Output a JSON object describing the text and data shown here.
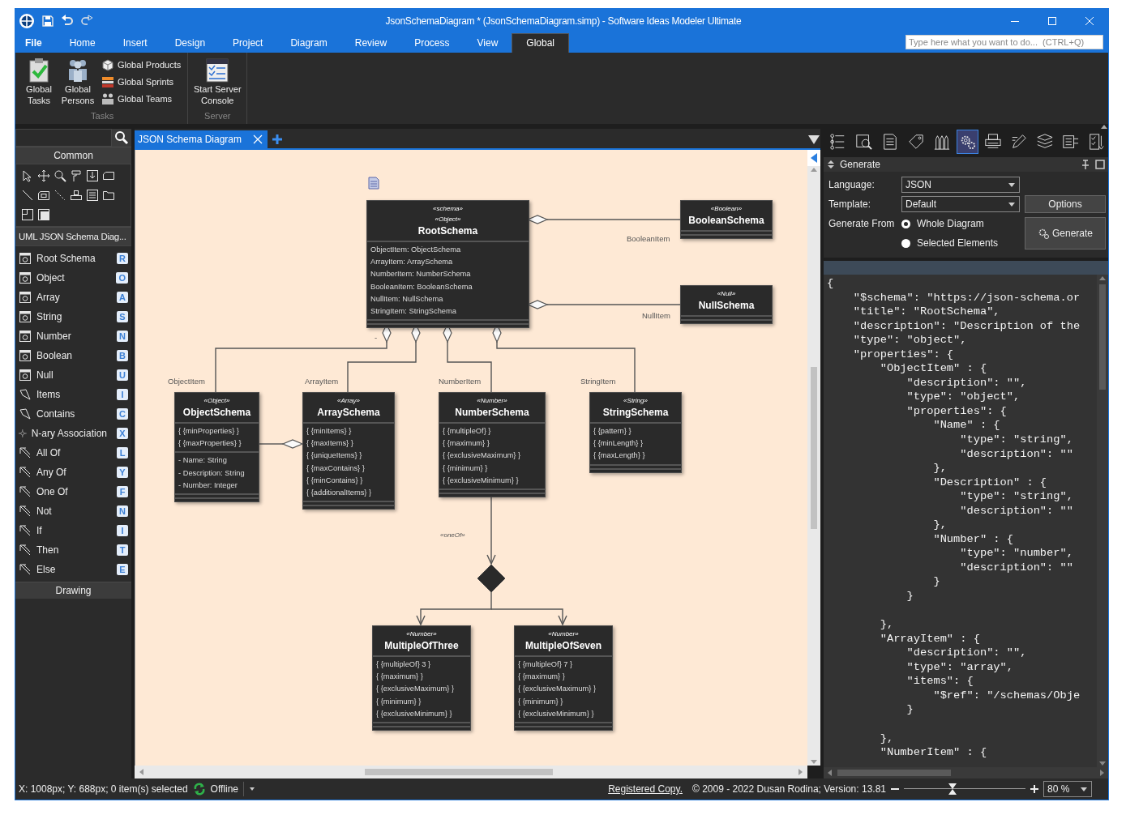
{
  "window": {
    "title": "JsonSchemaDiagram * (JsonSchemaDiagram.simp) - Software Ideas Modeler Ultimate"
  },
  "menu_tabs": [
    {
      "label": "File",
      "selected": false
    },
    {
      "label": "Home",
      "selected": false
    },
    {
      "label": "Insert",
      "selected": false
    },
    {
      "label": "Design",
      "selected": false
    },
    {
      "label": "Project",
      "selected": false
    },
    {
      "label": "Diagram",
      "selected": false
    },
    {
      "label": "Review",
      "selected": false
    },
    {
      "label": "Process",
      "selected": false
    },
    {
      "label": "View",
      "selected": false
    },
    {
      "label": "Global",
      "selected": true
    }
  ],
  "command_search": {
    "placeholder": "Type here what you want to do...  (CTRL+Q)"
  },
  "ribbon": {
    "groups": [
      {
        "label": "Tasks",
        "large_buttons": [
          {
            "label": "Global Tasks",
            "kind": "tasks"
          },
          {
            "label": "Global Persons",
            "kind": "persons"
          }
        ],
        "small_buttons": [
          {
            "label": "Global Products",
            "kind": "products"
          },
          {
            "label": "Global Sprints",
            "kind": "sprints"
          },
          {
            "label": "Global Teams",
            "kind": "teams"
          }
        ]
      },
      {
        "label": "Server",
        "large_buttons": [
          {
            "label": "Start Server Console",
            "kind": "console"
          }
        ]
      }
    ]
  },
  "toolbox": {
    "common_header": "Common",
    "diagram_header": "UML JSON Schema Diag...",
    "items": [
      {
        "label": "Root Schema",
        "shortcut": "R",
        "kind": "element"
      },
      {
        "label": "Object",
        "shortcut": "O",
        "kind": "element"
      },
      {
        "label": "Array",
        "shortcut": "A",
        "kind": "element"
      },
      {
        "label": "String",
        "shortcut": "S",
        "kind": "element"
      },
      {
        "label": "Number",
        "shortcut": "N",
        "kind": "element"
      },
      {
        "label": "Boolean",
        "shortcut": "B",
        "kind": "element"
      },
      {
        "label": "Null",
        "shortcut": "U",
        "kind": "element"
      },
      {
        "label": "Items",
        "shortcut": "I",
        "kind": "link"
      },
      {
        "label": "Contains",
        "shortcut": "C",
        "kind": "link"
      },
      {
        "label": "N-ary Association",
        "shortcut": "X",
        "kind": "nary"
      },
      {
        "label": "All Of",
        "shortcut": "L",
        "kind": "arrow"
      },
      {
        "label": "Any Of",
        "shortcut": "Y",
        "kind": "arrow"
      },
      {
        "label": "One Of",
        "shortcut": "F",
        "kind": "arrow"
      },
      {
        "label": "Not",
        "shortcut": "N",
        "kind": "arrow"
      },
      {
        "label": "If",
        "shortcut": "I",
        "kind": "arrow"
      },
      {
        "label": "Then",
        "shortcut": "T",
        "kind": "arrow"
      },
      {
        "label": "Else",
        "shortcut": "E",
        "kind": "arrow"
      }
    ],
    "drawing_header": "Drawing"
  },
  "document_tabs": [
    {
      "label": "JSON Schema Diagram",
      "selected": true
    }
  ],
  "diagram": {
    "nodes": [
      {
        "stereotypes": [
          "«schema»",
          "«Object»"
        ],
        "name": "RootSchema",
        "sections": [
          [
            "ObjectItem: ObjectSchema",
            "ArrayItem: ArraySchema",
            "NumberItem: NumberSchema",
            "BooleanItem: BooleanSchema",
            "NullItem: NullSchema",
            "StringItem: StringSchema"
          ]
        ]
      },
      {
        "stereotypes": [
          "«Boolean»"
        ],
        "name": "BooleanSchema"
      },
      {
        "stereotypes": [
          "«Null»"
        ],
        "name": "NullSchema"
      },
      {
        "stereotypes": [
          "«Object»"
        ],
        "name": "ObjectSchema",
        "sections": [
          [
            "{ {minProperties} }",
            "{ {maxProperties} }"
          ],
          [
            "- Name: String",
            "- Description: String",
            "- Number: Integer"
          ]
        ]
      },
      {
        "stereotypes": [
          "«Array»"
        ],
        "name": "ArraySchema",
        "sections": [
          [
            "{ {minItems} }",
            "{ {maxItems} }",
            "{ {uniqueItems} }",
            "{ {maxContains} }",
            "{ {minContains} }",
            "{ {additionalItems} }"
          ]
        ]
      },
      {
        "stereotypes": [
          "«Number»"
        ],
        "name": "NumberSchema",
        "sections": [
          [
            "{ {multipleOf} }",
            "{ {maximum} }",
            "{ {exclusiveMaximum} }",
            "{ {minimum} }",
            "{ {exclusiveMinimum} }"
          ]
        ]
      },
      {
        "stereotypes": [
          "«String»"
        ],
        "name": "StringSchema",
        "sections": [
          [
            "{ {pattern} }",
            "{ {minLength} }",
            "{ {maxLength} }"
          ]
        ]
      },
      {
        "stereotypes": [
          "«Number»"
        ],
        "name": "MultipleOfThree",
        "sections": [
          [
            "{ {multipleOf} 3 }",
            "{ {maximum} }",
            "{ {exclusiveMaximum} }",
            "{ {minimum} }",
            "{ {exclusiveMinimum} }"
          ]
        ]
      },
      {
        "stereotypes": [
          "«Number»"
        ],
        "name": "MultipleOfSeven",
        "sections": [
          [
            "{ {multipleOf} 7 }",
            "{ {maximum} }",
            "{ {exclusiveMaximum} }",
            "{ {minimum} }",
            "{ {exclusiveMinimum} }"
          ]
        ]
      }
    ],
    "connector_labels": [
      "BooleanItem",
      "NullItem",
      "ObjectItem",
      "ArrayItem",
      "NumberItem",
      "StringItem",
      "«oneOf»",
      "-"
    ]
  },
  "panel_tools": [
    {
      "kind": "tree",
      "selected": false
    },
    {
      "kind": "magnifier",
      "selected": false
    },
    {
      "kind": "document",
      "selected": false
    },
    {
      "kind": "tag",
      "selected": false
    },
    {
      "kind": "pencils",
      "selected": false
    },
    {
      "kind": "gear",
      "selected": true
    },
    {
      "kind": "printer",
      "selected": false
    },
    {
      "kind": "pen",
      "selected": false
    },
    {
      "kind": "layers",
      "selected": false
    },
    {
      "kind": "list",
      "selected": false
    },
    {
      "kind": "checklist",
      "selected": false
    }
  ],
  "generate_panel": {
    "title": "Generate",
    "language_label": "Language:",
    "language": "JSON",
    "template_label": "Template:",
    "template": "Default",
    "options_button": "Options",
    "generate_from_label": "Generate From",
    "sources": [
      {
        "label": "Whole Diagram",
        "selected": true
      },
      {
        "label": "Selected Elements",
        "selected": false
      }
    ],
    "generate_button": "Generate",
    "output": "{\n    \"$schema\": \"https://json-schema.or\n    \"title\": \"RootSchema\",\n    \"description\": \"Description of the\n    \"type\": \"object\",\n    \"properties\": {\n        \"ObjectItem\" : {\n            \"description\": \"\",\n            \"type\": \"object\",\n            \"properties\": {\n                \"Name\" : {\n                    \"type\": \"string\",\n                    \"description\": \"\"\n                },\n                \"Description\" : {\n                    \"type\": \"string\",\n                    \"description\": \"\"\n                },\n                \"Number\" : {\n                    \"type\": \"number\",\n                    \"description\": \"\"\n                }\n            }\n\n        },\n        \"ArrayItem\" : {\n            \"description\": \"\",\n            \"type\": \"array\",\n            \"items\": {\n                \"$ref\": \"/schemas/Obje\n            }\n\n        },\n        \"NumberItem\" : {"
  },
  "status_bar": {
    "position": "X: 1008px; Y: 688px; 0 item(s) selected",
    "connection": "Offline",
    "license_link": "Registered Copy.",
    "copyright": "© 2009 - 2022 Dusan Rodina; Version: 13.81",
    "zoom": {
      "level": 0.4
    },
    "zoom_value": "80 %"
  }
}
